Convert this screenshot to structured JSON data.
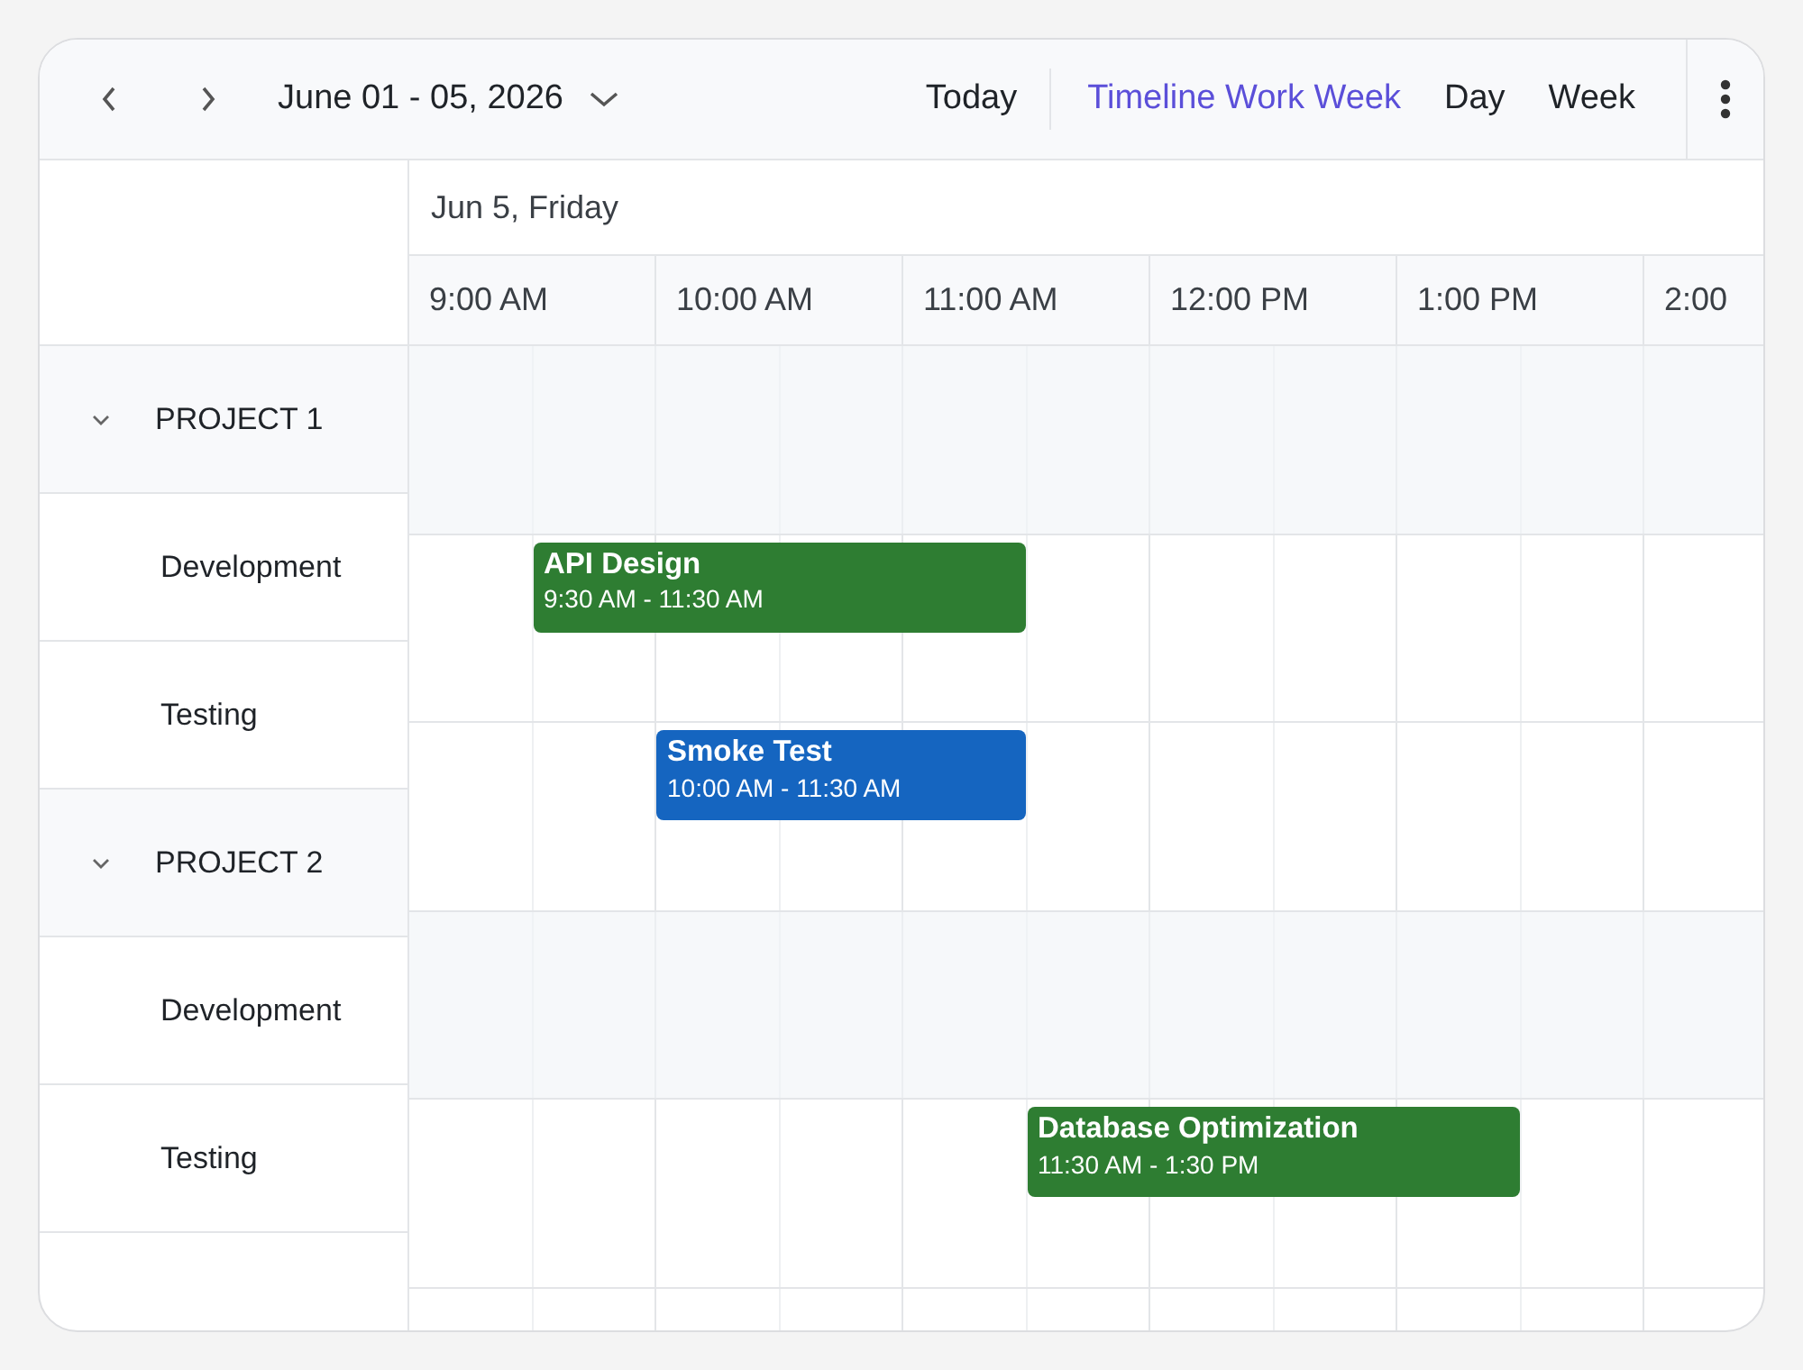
{
  "toolbar": {
    "date_range": "June 01 - 05, 2026",
    "today": "Today",
    "views": [
      {
        "label": "Timeline Work Week",
        "selected": true
      },
      {
        "label": "Day",
        "selected": false
      },
      {
        "label": "Week",
        "selected": false
      }
    ]
  },
  "date_header": "Jun 5, Friday",
  "time_slots": [
    "9:00 AM",
    "10:00 AM",
    "11:00 AM",
    "12:00 PM",
    "1:00 PM",
    "2:00"
  ],
  "resources": [
    {
      "label": "PROJECT 1",
      "expanded": true,
      "children": [
        {
          "label": "Development",
          "events": [
            {
              "title": "API Design",
              "time": "9:30 AM - 11:30 AM",
              "color": "#2e7d32"
            }
          ]
        },
        {
          "label": "Testing",
          "events": [
            {
              "title": "Smoke Test",
              "time": "10:00 AM - 11:30 AM",
              "color": "#1565c0"
            }
          ]
        }
      ]
    },
    {
      "label": "PROJECT 2",
      "expanded": true,
      "children": [
        {
          "label": "Development",
          "events": [
            {
              "title": "Database Optimization",
              "time": "11:30 AM - 1:30 PM",
              "color": "#2e7d32"
            }
          ]
        },
        {
          "label": "Testing"
        }
      ]
    }
  ]
}
